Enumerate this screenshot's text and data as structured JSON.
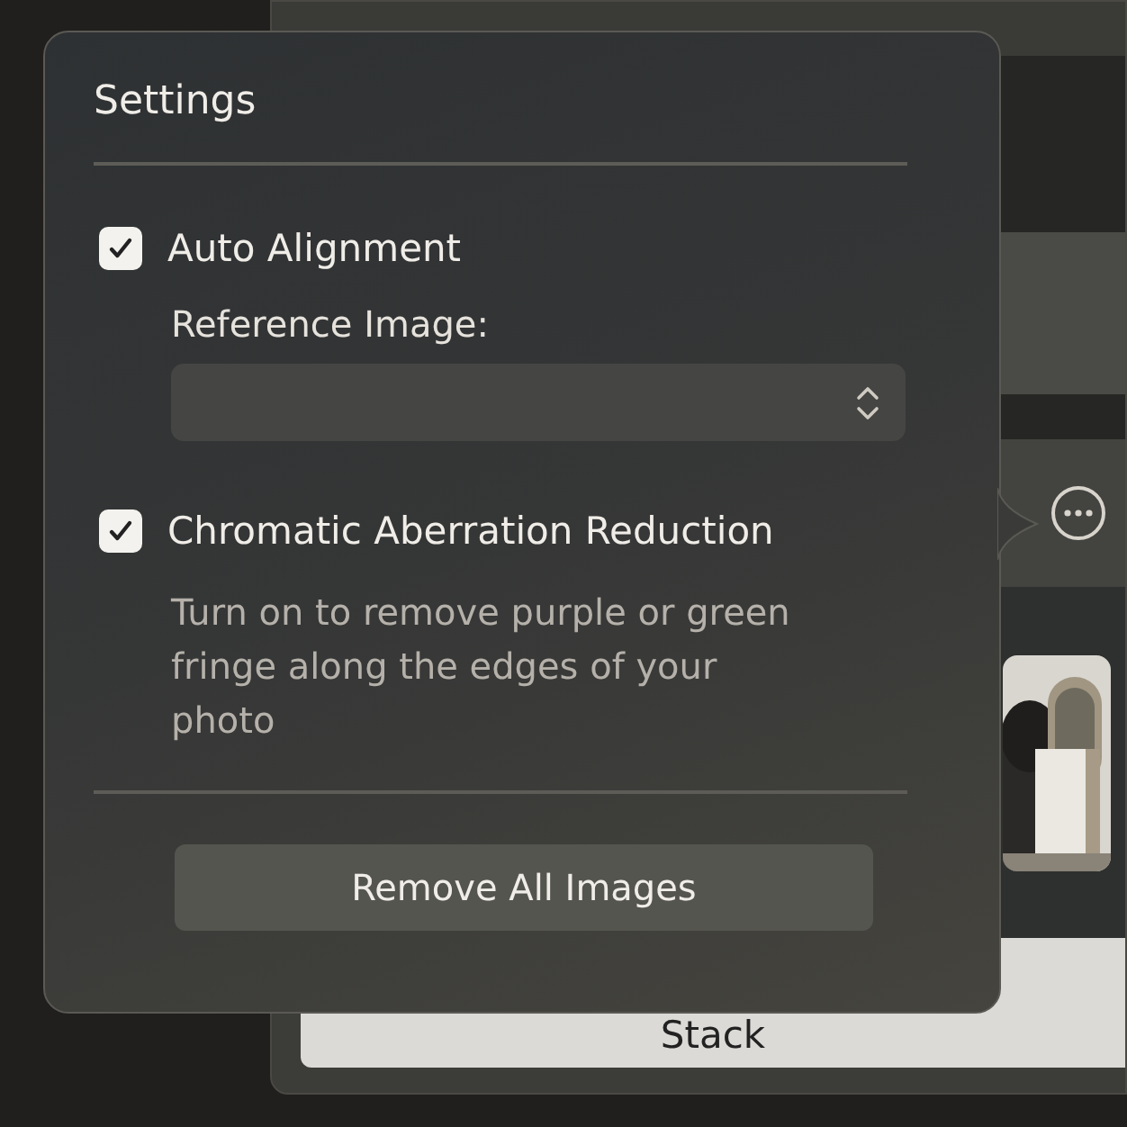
{
  "popover": {
    "title": "Settings",
    "auto_alignment": {
      "label": "Auto Alignment",
      "checked": true
    },
    "reference_image": {
      "label": "Reference Image:"
    },
    "chromatic_aberration": {
      "label": "Chromatic Aberration Reduction",
      "checked": true,
      "description": "Turn on to remove purple or green fringe along the edges of your photo"
    },
    "button": "Remove All Images"
  },
  "background_window": {
    "stack_button": "Stack"
  }
}
